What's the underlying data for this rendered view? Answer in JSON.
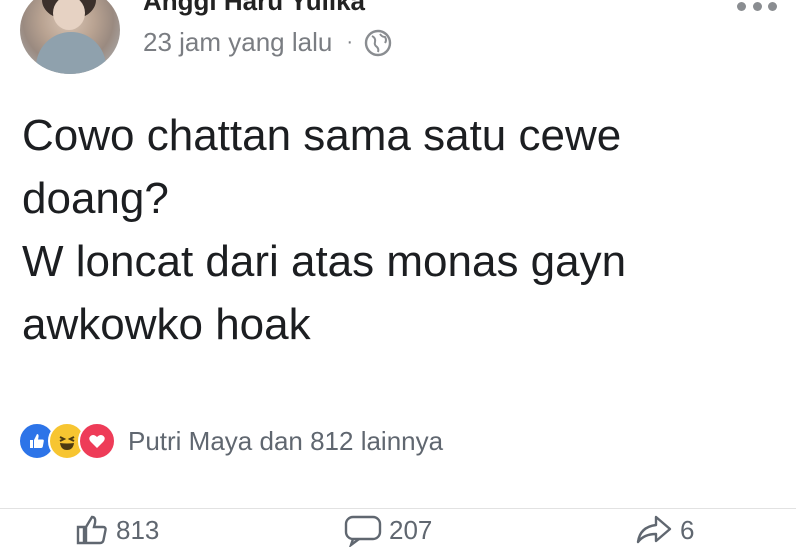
{
  "post": {
    "author_name": "Anggi Haru Yulika",
    "timestamp": "23 jam yang lalu",
    "separator": "·",
    "privacy_icon": "globe-icon",
    "text_lines": [
      "Cowo chattan sama satu cewe",
      "doang?",
      "W loncat dari atas monas gayn",
      "awkowko hoak"
    ],
    "reactions": {
      "icons": [
        "like-icon",
        "haha-icon",
        "love-icon"
      ],
      "summary": "Putri Maya dan 812 lainnya"
    },
    "actions": {
      "like_count": "813",
      "comment_count": "207",
      "share_count": "6"
    }
  },
  "colors": {
    "like": "#2d74e8",
    "haha": "#f7c531",
    "love": "#ee3c58",
    "secondary_text": "#606770"
  }
}
